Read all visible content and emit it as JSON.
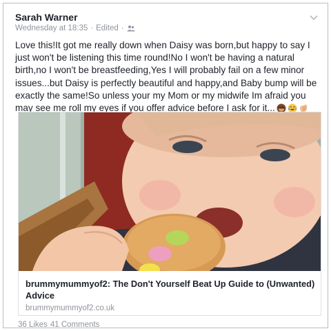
{
  "post": {
    "author": "Sarah Warner",
    "timestamp": "Wednesday at 18:35",
    "separator": "·",
    "edited": "Edited",
    "separator2": "·",
    "audience_icon": "friends-icon",
    "text": "Love this!It got me really down when Daisy was born,but happy to say I just won't be listening this time round!No I won't be having a natural birth,no I won't be breastfeeding,Yes I will probably fail on a few minor issues...but Daisy is perfectly beautiful and happy,and Baby bump will be exactly the same!So unless your my Mom or my midwife Im afraid you may see me roll my eyes if you offer advice before I ask for it...",
    "emojis": [
      "see-no-evil-monkey",
      "tears-of-joy",
      "clapping-hands"
    ]
  },
  "link_card": {
    "title": "brummymummyof2: The Don't Yourself Beat Up Guide to (Unwanted) Advice",
    "domain": "brummymummyof2.co.uk",
    "image": "photo of a smiling toddler biting a biscuit decorated with candy buttons"
  },
  "footer": {
    "likes": "36 Likes",
    "comments": "41 Comments"
  },
  "colors": {
    "text": "#1d2129",
    "meta": "#90949c",
    "border": "#dddfe2"
  }
}
